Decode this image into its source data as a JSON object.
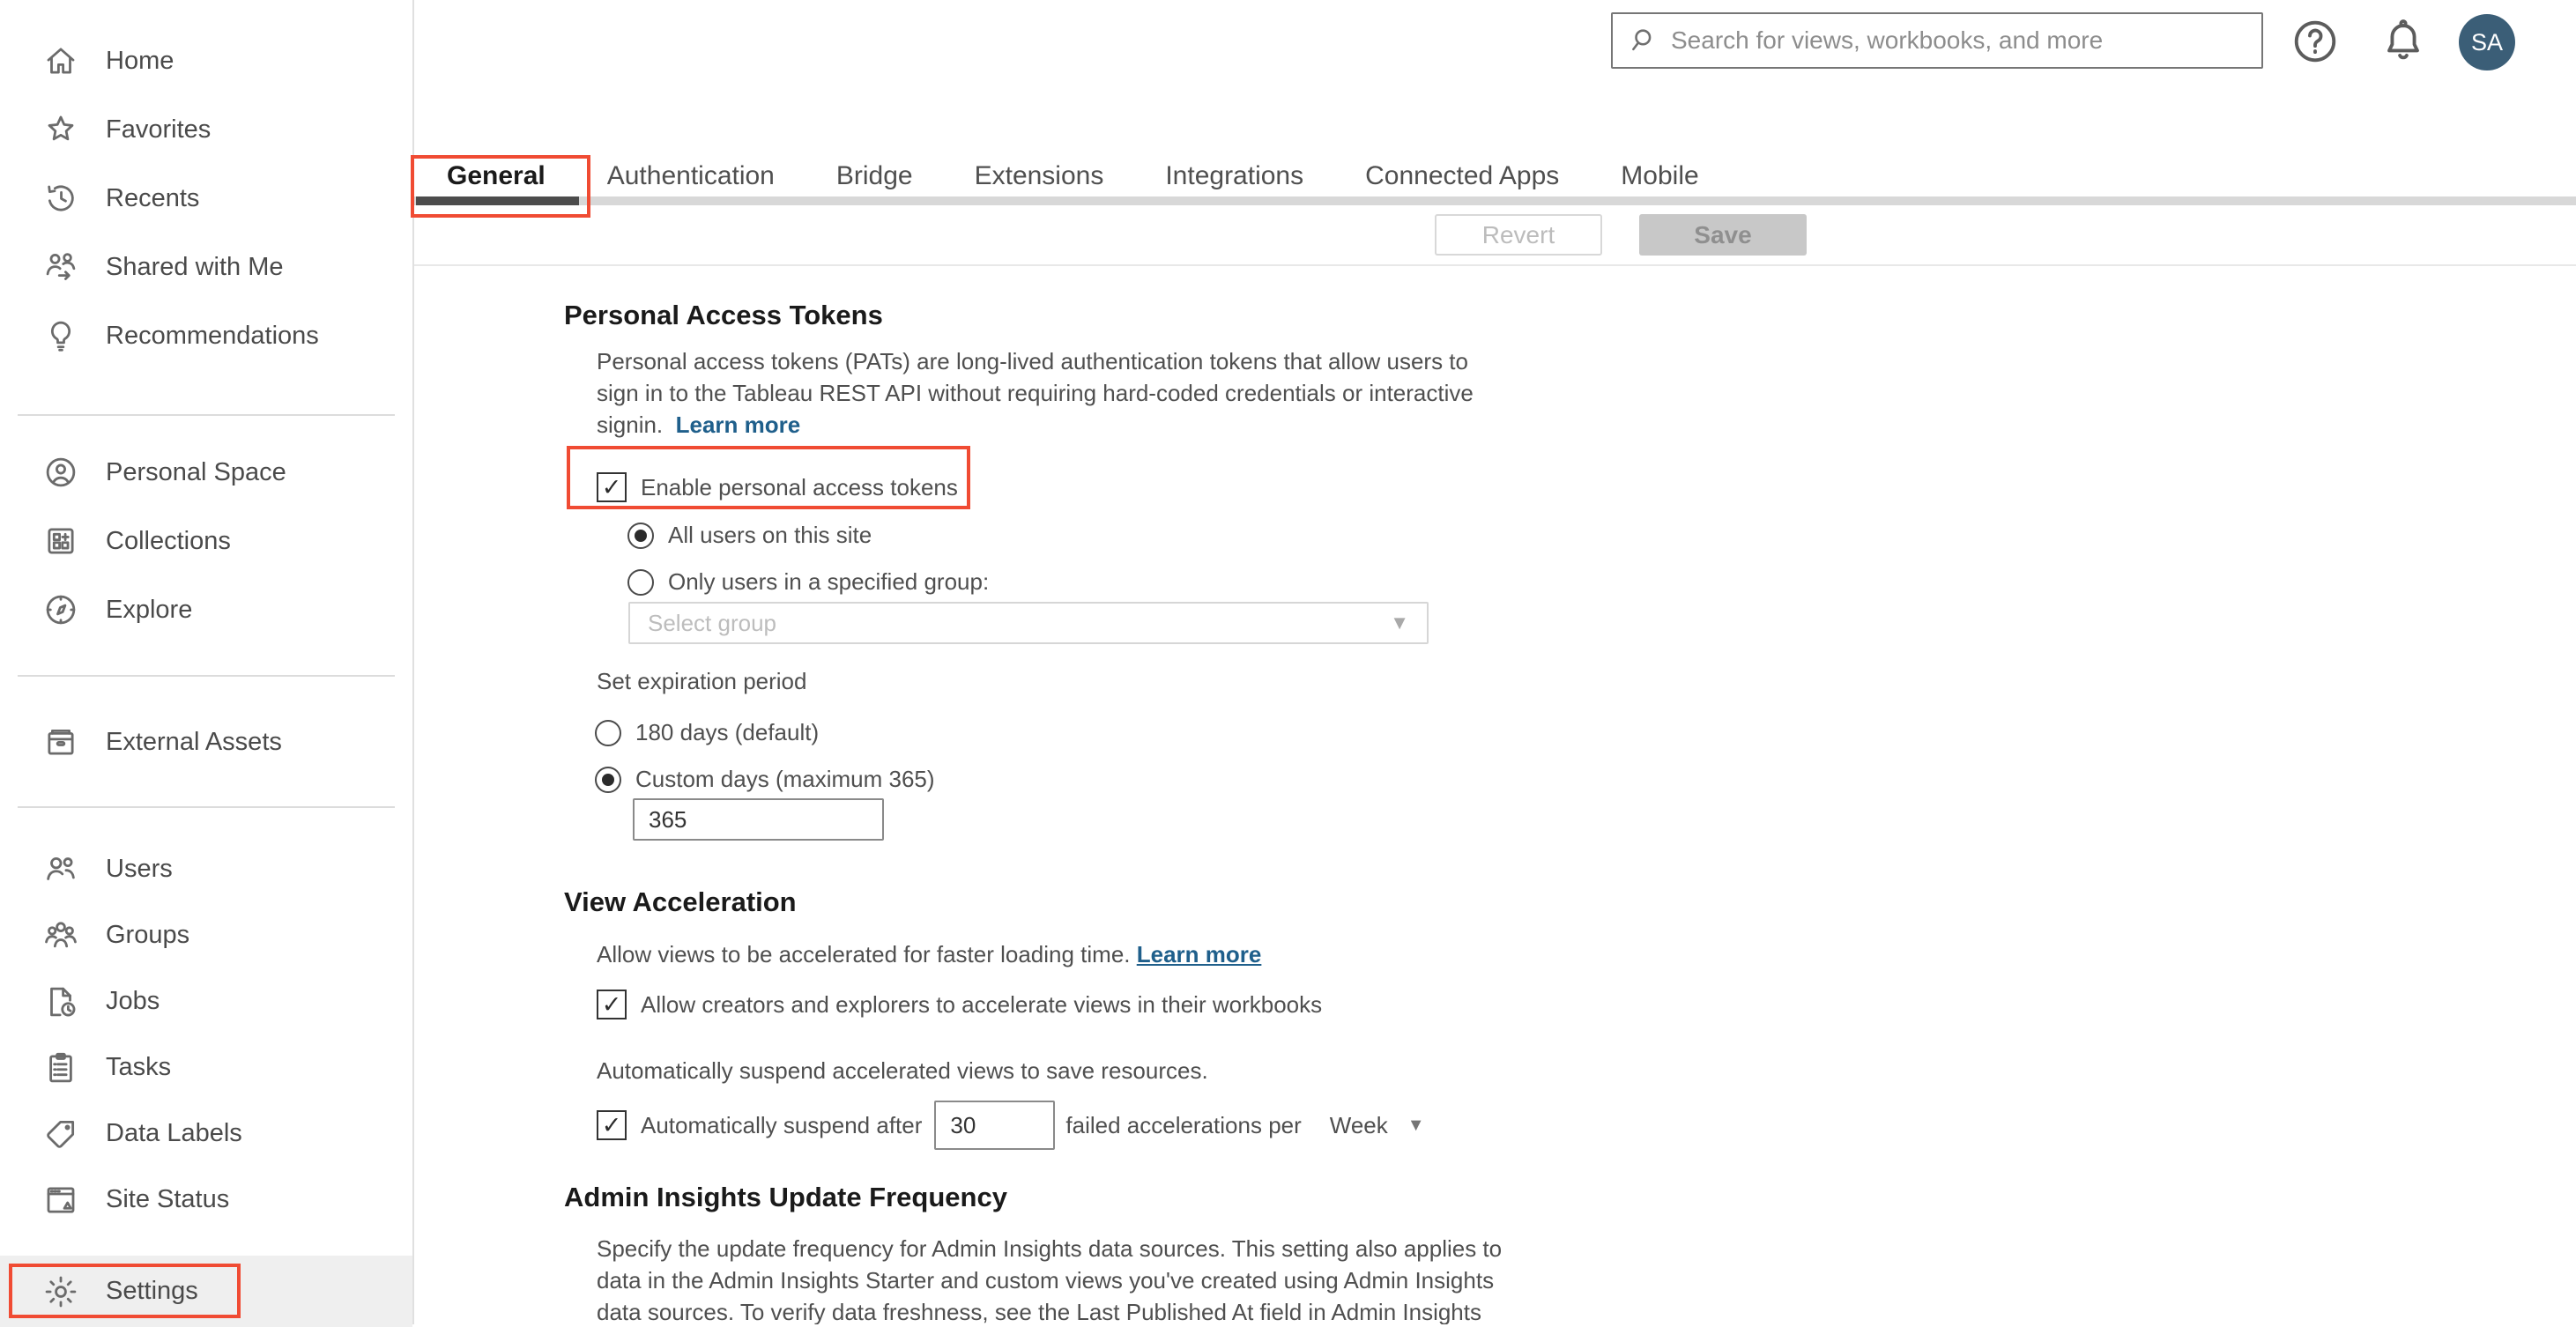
{
  "topbar": {
    "search_placeholder": "Search for views, workbooks, and more",
    "avatar_initials": "SA"
  },
  "sidebar": {
    "sections": [
      {
        "items": [
          {
            "label": "Home",
            "icon": "home-icon"
          },
          {
            "label": "Favorites",
            "icon": "star-icon"
          },
          {
            "label": "Recents",
            "icon": "history-clock-icon"
          },
          {
            "label": "Shared with Me",
            "icon": "shared-with-me-icon"
          },
          {
            "label": "Recommendations",
            "icon": "lightbulb-icon"
          }
        ]
      },
      {
        "items": [
          {
            "label": "Personal Space",
            "icon": "person-circle-icon"
          },
          {
            "label": "Collections",
            "icon": "collections-grid-icon"
          },
          {
            "label": "Explore",
            "icon": "compass-icon"
          }
        ]
      },
      {
        "items": [
          {
            "label": "External Assets",
            "icon": "archive-box-icon"
          }
        ]
      },
      {
        "items": [
          {
            "label": "Users",
            "icon": "users-icon"
          },
          {
            "label": "Groups",
            "icon": "groups-icon"
          },
          {
            "label": "Jobs",
            "icon": "document-clock-icon"
          },
          {
            "label": "Tasks",
            "icon": "clipboard-list-icon"
          },
          {
            "label": "Data Labels",
            "icon": "tag-icon"
          },
          {
            "label": "Site Status",
            "icon": "browser-warning-icon"
          },
          {
            "label": "Settings",
            "icon": "gear-icon",
            "selected": true
          }
        ]
      }
    ]
  },
  "tabs": {
    "items": [
      "General",
      "Authentication",
      "Bridge",
      "Extensions",
      "Integrations",
      "Connected Apps",
      "Mobile"
    ],
    "active": "General"
  },
  "toolbar": {
    "revert_label": "Revert",
    "save_label": "Save"
  },
  "sections": {
    "pat": {
      "heading": "Personal Access Tokens",
      "description_lines": [
        "Personal access tokens (PATs) are long-lived authentication tokens that allow users to",
        "sign in to the Tableau REST API without requiring hard-coded credentials or interactive",
        "signin."
      ],
      "learn_more": "Learn more",
      "enable_checkbox": "Enable personal access tokens",
      "radio_all_users": "All users on this site",
      "radio_specified_group": "Only users in a specified group:",
      "group_select_placeholder": "Select group",
      "expiration_label": "Set expiration period",
      "radio_default": "180 days (default)",
      "radio_custom": "Custom days (maximum 365)",
      "custom_days_value": "365"
    },
    "view_acceleration": {
      "heading": "View Acceleration",
      "description": "Allow views to be accelerated for faster loading time.",
      "learn_more": "Learn more",
      "allow_checkbox": "Allow creators and explorers to accelerate views in their workbooks",
      "suspend_note": "Automatically suspend accelerated views to save resources.",
      "suspend_prefix": "Automatically suspend after",
      "suspend_threshold_value": "30",
      "suspend_suffix": "failed accelerations per",
      "suspend_period_value": "Week"
    },
    "admin_insights": {
      "heading": "Admin Insights Update Frequency",
      "description_lines": [
        "Specify the update frequency for Admin Insights data sources. This setting also applies to",
        "data in the Admin Insights Starter and custom views you've created using Admin Insights",
        "data sources. To verify data freshness, see the Last Published At field in Admin Insights"
      ]
    }
  },
  "colors": {
    "annotation_red": "#f04b33",
    "link_blue": "#1f5f8b",
    "avatar_bg": "#3b5e77",
    "active_tab_underline": "#4c4c4c"
  }
}
